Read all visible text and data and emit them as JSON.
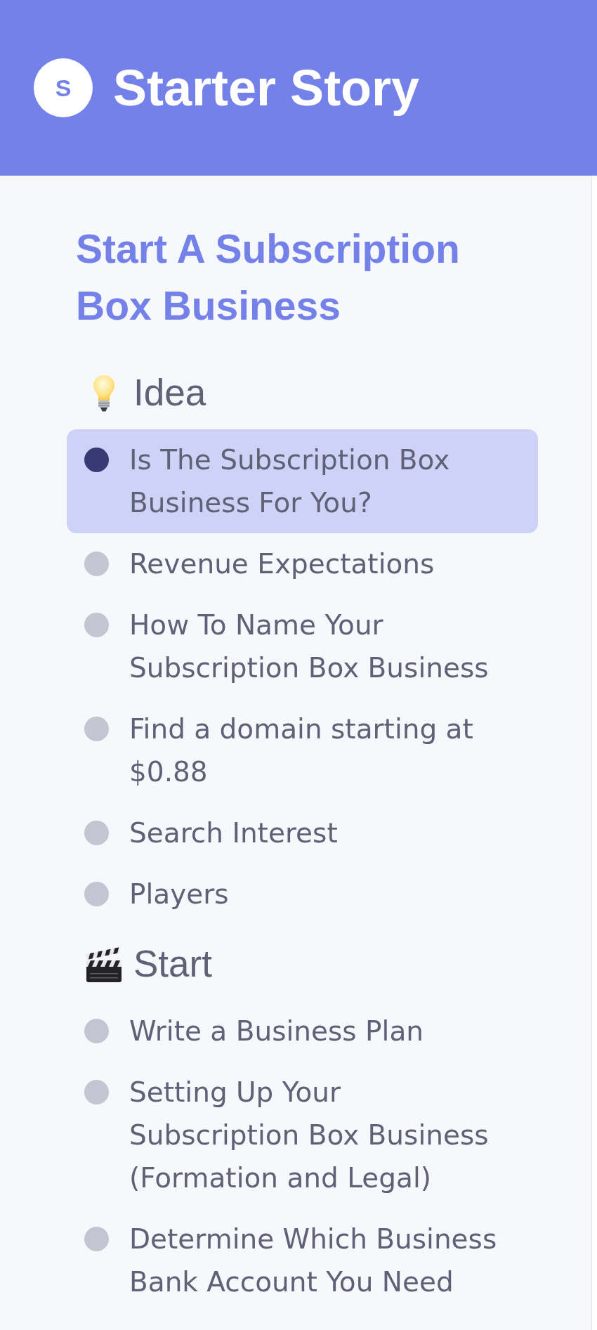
{
  "header": {
    "logo_letter": "S",
    "title": "Starter Story"
  },
  "guide_title": "Start A Subscription Box Business",
  "sections": [
    {
      "title": "Idea",
      "items": [
        {
          "label": "Is The Subscription Box Business For You?",
          "selected": true
        },
        {
          "label": "Revenue Expectations",
          "selected": false
        },
        {
          "label": "How To Name Your Subscription Box Business",
          "selected": false
        },
        {
          "label": "Find a domain starting at $0.88",
          "selected": false
        },
        {
          "label": "Search Interest",
          "selected": false
        },
        {
          "label": "Players",
          "selected": false
        }
      ]
    },
    {
      "title": "Start",
      "items": [
        {
          "label": "Write a Business Plan",
          "selected": false
        },
        {
          "label": "Setting Up Your Subscription Box Business (Formation and Legal)",
          "selected": false
        },
        {
          "label": "Determine Which Business Bank Account You Need",
          "selected": false
        }
      ]
    }
  ]
}
